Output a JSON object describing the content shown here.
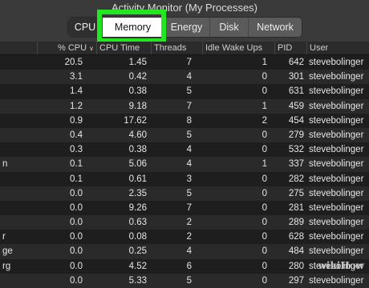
{
  "window": {
    "title": "Activity Monitor (My Processes)"
  },
  "tabs": [
    "CPU",
    "Memory",
    "Energy",
    "Disk",
    "Network"
  ],
  "columns": {
    "cpu": "% CPU",
    "cpu_sort_icon": "chevron-down",
    "cpu_time": "CPU Time",
    "threads": "Threads",
    "idle_wake_ups": "Idle Wake Ups",
    "pid": "PID",
    "user": "User"
  },
  "rows": [
    {
      "name": "",
      "cpu": "20.5",
      "cpu_time": "1.45",
      "threads": "7",
      "idle": "1",
      "pid": "642",
      "user": "stevebolinger"
    },
    {
      "name": "",
      "cpu": "3.1",
      "cpu_time": "0.42",
      "threads": "4",
      "idle": "0",
      "pid": "301",
      "user": "stevebolinger"
    },
    {
      "name": "",
      "cpu": "1.4",
      "cpu_time": "0.38",
      "threads": "5",
      "idle": "0",
      "pid": "631",
      "user": "stevebolinger"
    },
    {
      "name": "",
      "cpu": "1.2",
      "cpu_time": "9.18",
      "threads": "7",
      "idle": "1",
      "pid": "459",
      "user": "stevebolinger"
    },
    {
      "name": "",
      "cpu": "0.9",
      "cpu_time": "17.62",
      "threads": "8",
      "idle": "2",
      "pid": "454",
      "user": "stevebolinger"
    },
    {
      "name": "",
      "cpu": "0.4",
      "cpu_time": "4.60",
      "threads": "5",
      "idle": "0",
      "pid": "279",
      "user": "stevebolinger"
    },
    {
      "name": "",
      "cpu": "0.3",
      "cpu_time": "0.38",
      "threads": "4",
      "idle": "0",
      "pid": "532",
      "user": "stevebolinger"
    },
    {
      "name": "n",
      "cpu": "0.1",
      "cpu_time": "5.06",
      "threads": "4",
      "idle": "1",
      "pid": "337",
      "user": "stevebolinger"
    },
    {
      "name": "",
      "cpu": "0.1",
      "cpu_time": "0.61",
      "threads": "3",
      "idle": "0",
      "pid": "282",
      "user": "stevebolinger"
    },
    {
      "name": "",
      "cpu": "0.0",
      "cpu_time": "2.35",
      "threads": "5",
      "idle": "0",
      "pid": "275",
      "user": "stevebolinger"
    },
    {
      "name": "",
      "cpu": "0.0",
      "cpu_time": "9.26",
      "threads": "7",
      "idle": "0",
      "pid": "281",
      "user": "stevebolinger"
    },
    {
      "name": "",
      "cpu": "0.0",
      "cpu_time": "0.63",
      "threads": "2",
      "idle": "0",
      "pid": "289",
      "user": "stevebolinger"
    },
    {
      "name": "r",
      "cpu": "0.0",
      "cpu_time": "0.08",
      "threads": "2",
      "idle": "0",
      "pid": "628",
      "user": "stevebolinger"
    },
    {
      "name": "ge",
      "cpu": "0.0",
      "cpu_time": "0.25",
      "threads": "4",
      "idle": "0",
      "pid": "484",
      "user": "stevebolinger"
    },
    {
      "name": "rg",
      "cpu": "0.0",
      "cpu_time": "4.52",
      "threads": "6",
      "idle": "0",
      "pid": "280",
      "user": "stevebolinger"
    },
    {
      "name": "",
      "cpu": "0.0",
      "cpu_time": "5.33",
      "threads": "5",
      "idle": "0",
      "pid": "297",
      "user": "stevebolinger"
    }
  ],
  "watermark": "wikiHow",
  "colors": {
    "highlight": "#22e61e"
  }
}
